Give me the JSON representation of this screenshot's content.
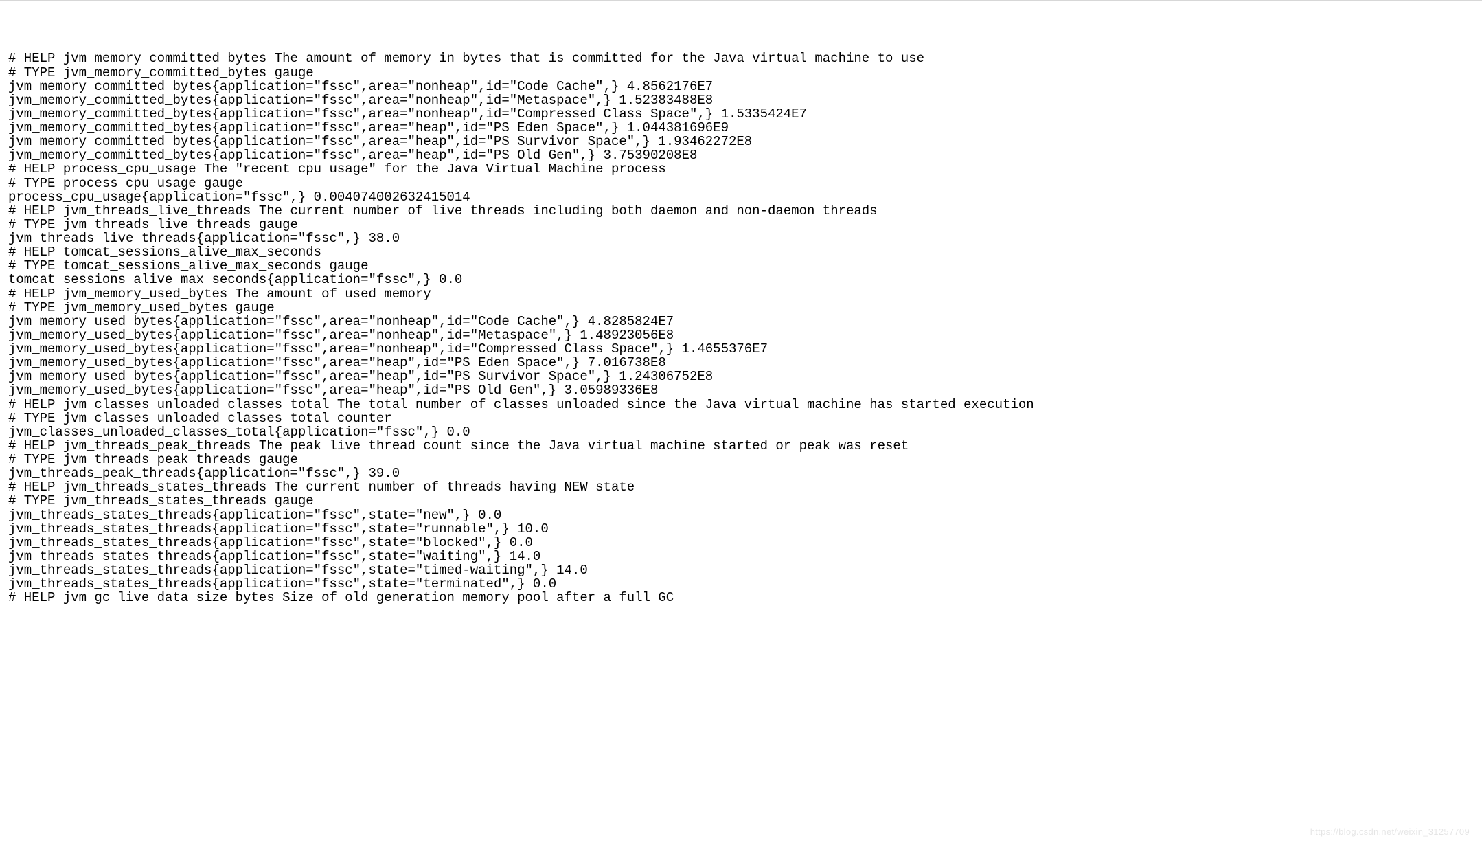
{
  "lines": [
    "# HELP jvm_memory_committed_bytes The amount of memory in bytes that is committed for the Java virtual machine to use",
    "# TYPE jvm_memory_committed_bytes gauge",
    "jvm_memory_committed_bytes{application=\"fssc\",area=\"nonheap\",id=\"Code Cache\",} 4.8562176E7",
    "jvm_memory_committed_bytes{application=\"fssc\",area=\"nonheap\",id=\"Metaspace\",} 1.52383488E8",
    "jvm_memory_committed_bytes{application=\"fssc\",area=\"nonheap\",id=\"Compressed Class Space\",} 1.5335424E7",
    "jvm_memory_committed_bytes{application=\"fssc\",area=\"heap\",id=\"PS Eden Space\",} 1.044381696E9",
    "jvm_memory_committed_bytes{application=\"fssc\",area=\"heap\",id=\"PS Survivor Space\",} 1.93462272E8",
    "jvm_memory_committed_bytes{application=\"fssc\",area=\"heap\",id=\"PS Old Gen\",} 3.75390208E8",
    "# HELP process_cpu_usage The \"recent cpu usage\" for the Java Virtual Machine process",
    "# TYPE process_cpu_usage gauge",
    "process_cpu_usage{application=\"fssc\",} 0.004074002632415014",
    "# HELP jvm_threads_live_threads The current number of live threads including both daemon and non-daemon threads",
    "# TYPE jvm_threads_live_threads gauge",
    "jvm_threads_live_threads{application=\"fssc\",} 38.0",
    "# HELP tomcat_sessions_alive_max_seconds ",
    "# TYPE tomcat_sessions_alive_max_seconds gauge",
    "tomcat_sessions_alive_max_seconds{application=\"fssc\",} 0.0",
    "# HELP jvm_memory_used_bytes The amount of used memory",
    "# TYPE jvm_memory_used_bytes gauge",
    "jvm_memory_used_bytes{application=\"fssc\",area=\"nonheap\",id=\"Code Cache\",} 4.8285824E7",
    "jvm_memory_used_bytes{application=\"fssc\",area=\"nonheap\",id=\"Metaspace\",} 1.48923056E8",
    "jvm_memory_used_bytes{application=\"fssc\",area=\"nonheap\",id=\"Compressed Class Space\",} 1.4655376E7",
    "jvm_memory_used_bytes{application=\"fssc\",area=\"heap\",id=\"PS Eden Space\",} 7.016738E8",
    "jvm_memory_used_bytes{application=\"fssc\",area=\"heap\",id=\"PS Survivor Space\",} 1.24306752E8",
    "jvm_memory_used_bytes{application=\"fssc\",area=\"heap\",id=\"PS Old Gen\",} 3.05989336E8",
    "# HELP jvm_classes_unloaded_classes_total The total number of classes unloaded since the Java virtual machine has started execution",
    "# TYPE jvm_classes_unloaded_classes_total counter",
    "jvm_classes_unloaded_classes_total{application=\"fssc\",} 0.0",
    "# HELP jvm_threads_peak_threads The peak live thread count since the Java virtual machine started or peak was reset",
    "# TYPE jvm_threads_peak_threads gauge",
    "jvm_threads_peak_threads{application=\"fssc\",} 39.0",
    "# HELP jvm_threads_states_threads The current number of threads having NEW state",
    "# TYPE jvm_threads_states_threads gauge",
    "jvm_threads_states_threads{application=\"fssc\",state=\"new\",} 0.0",
    "jvm_threads_states_threads{application=\"fssc\",state=\"runnable\",} 10.0",
    "jvm_threads_states_threads{application=\"fssc\",state=\"blocked\",} 0.0",
    "jvm_threads_states_threads{application=\"fssc\",state=\"waiting\",} 14.0",
    "jvm_threads_states_threads{application=\"fssc\",state=\"timed-waiting\",} 14.0",
    "jvm_threads_states_threads{application=\"fssc\",state=\"terminated\",} 0.0",
    "# HELP jvm_gc_live_data_size_bytes Size of old generation memory pool after a full GC"
  ],
  "watermark": "https://blog.csdn.net/weixin_31257709"
}
